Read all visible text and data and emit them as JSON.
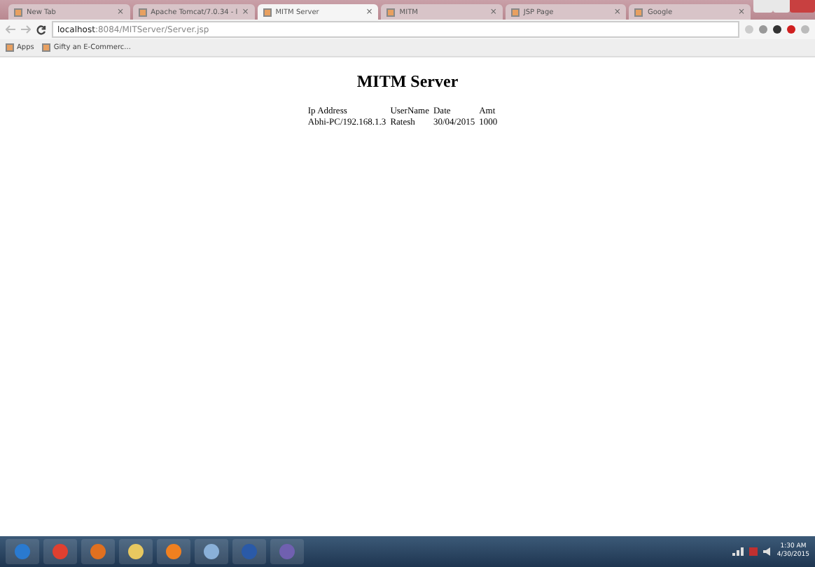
{
  "tabs": [
    {
      "title": "New Tab",
      "close": "×",
      "selected": false
    },
    {
      "title": "Apache Tomcat/7.0.34 - l",
      "close": "×",
      "selected": false
    },
    {
      "title": "MITM Server",
      "close": "×",
      "selected": true
    },
    {
      "title": "MITM",
      "close": "×",
      "selected": false
    },
    {
      "title": "JSP Page",
      "close": "×",
      "selected": false
    },
    {
      "title": "Google",
      "close": "×",
      "selected": false
    }
  ],
  "address": {
    "host": "localhost",
    "path": ":8084/MITServer/Server.jsp"
  },
  "bookmarks": [
    {
      "label": "Apps"
    },
    {
      "label": "Gifty an E-Commerc..."
    }
  ],
  "page": {
    "heading": "MITM Server",
    "table": {
      "columns": [
        "Ip Address",
        "UserName",
        "Date",
        "Amt"
      ],
      "rows": [
        [
          "Abhi-PC/192.168.1.3",
          "Ratesh",
          "30/04/2015",
          "1000"
        ]
      ]
    }
  },
  "taskbar": {
    "clock": {
      "time": "1:30 AM",
      "date": "4/30/2015"
    }
  }
}
